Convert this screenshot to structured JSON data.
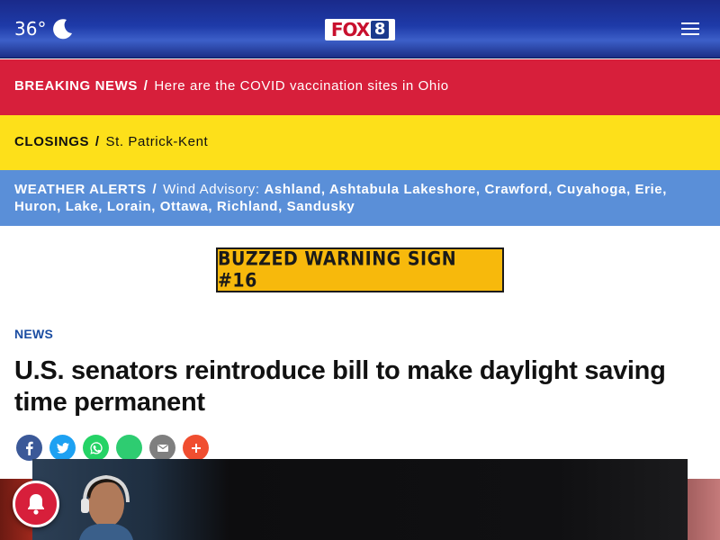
{
  "header": {
    "temperature": "36°",
    "weather_icon": "moon-icon",
    "logo": {
      "name": "FOX 8",
      "text": "FOX8",
      "brand_color": "#c8102e"
    },
    "menu_icon": "hamburger-menu-icon"
  },
  "alerts": {
    "breaking": {
      "label": "BREAKING NEWS",
      "separator": "/",
      "text": "Here are the COVID vaccination sites in Ohio",
      "color": "#d71f3b"
    },
    "closings": {
      "label": "CLOSINGS",
      "separator": "/",
      "text": "St. Patrick-Kent",
      "color": "#fde01a"
    },
    "weather": {
      "label": "WEATHER ALERTS",
      "separator": "/",
      "advisory": "Wind Advisory:",
      "places": "Ashland, Ashtabula Lakeshore, Crawford, Cuyahoga, Erie, Huron, Lake, Lorain, Ottawa, Richland, Sandusky",
      "color": "#5a8fd8"
    }
  },
  "ad": {
    "text": "BUZZED WARNING SIGN #16"
  },
  "article": {
    "category": "NEWS",
    "headline": "U.S. senators reintroduce bill to make daylight saving time permanent"
  },
  "share_buttons": [
    {
      "icon": "facebook-icon",
      "color": "#3b5998"
    },
    {
      "icon": "twitter-icon",
      "color": "#1da1f2"
    },
    {
      "icon": "whatsapp-icon",
      "color": "#25d366"
    },
    {
      "icon": "sms-icon",
      "color": "#2ecc71"
    },
    {
      "icon": "email-icon",
      "color": "#7f7f7f"
    },
    {
      "icon": "more-share-icon",
      "color": "#f04e30"
    }
  ],
  "notification_button": {
    "icon": "bell-icon",
    "color": "#d71f3b"
  }
}
